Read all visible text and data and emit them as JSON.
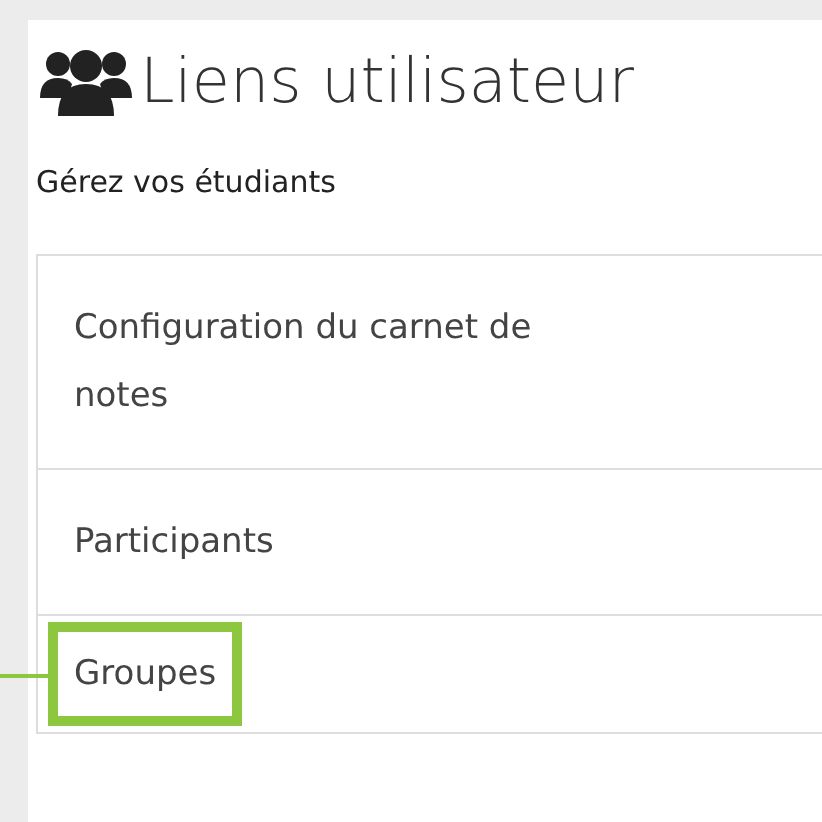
{
  "header": {
    "title": "Liens utilisateur",
    "subtitle": "Gérez vos étudiants"
  },
  "links": [
    {
      "label": "Configuration du carnet de notes",
      "highlighted": false
    },
    {
      "label": "Participants",
      "highlighted": false
    },
    {
      "label": "Groupes",
      "highlighted": true
    }
  ]
}
